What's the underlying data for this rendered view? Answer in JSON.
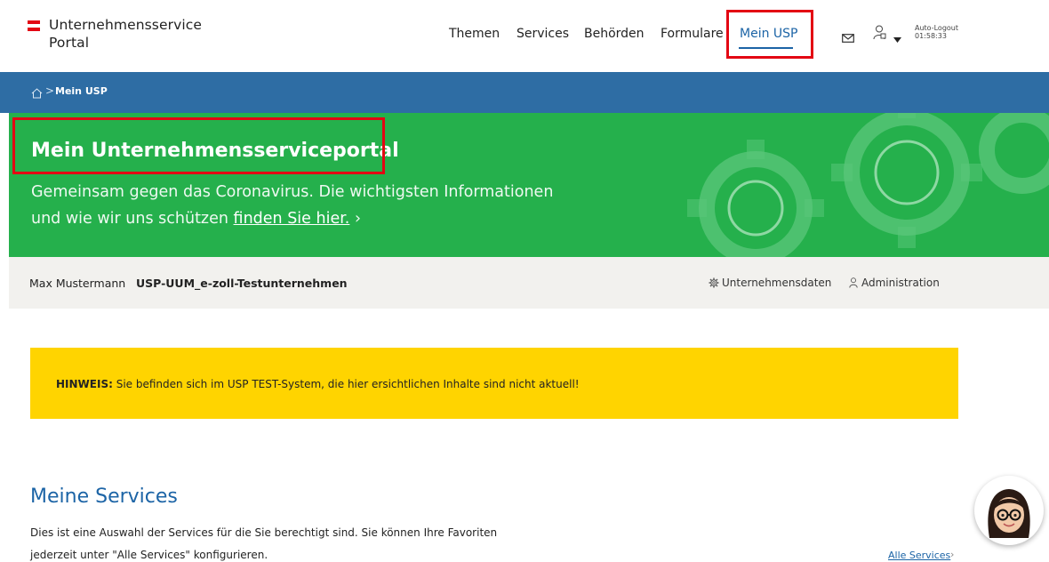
{
  "header": {
    "logo_line1": "Unternehmensservice",
    "logo_line2": "Portal",
    "nav": [
      "Themen",
      "Services",
      "Behörden",
      "Formulare",
      "Mein USP"
    ],
    "active_nav": "Mein USP",
    "auto_logout_label": "Auto-Logout",
    "auto_logout_time": "01:58:33",
    "icons": [
      "mail-icon",
      "user-icon",
      "caret-down-icon"
    ]
  },
  "breadcrumb": {
    "home_icon": "home-icon",
    "separator": ">",
    "current": "Mein USP"
  },
  "hero": {
    "title": "Mein Unternehmensserviceportal",
    "text_line1": "Gemeinsam gegen das Coronavirus. Die wichtigsten Informationen",
    "text_line2_prefix": "und wie wir uns schützen ",
    "link_text": "finden Sie hier.",
    "link_chevron": "›"
  },
  "userbar": {
    "name": "Max Mustermann",
    "company": "USP-UUM_e-zoll-Testunternehmen",
    "company_data_link": "Unternehmensdaten",
    "administration_link": "Administration"
  },
  "notice": {
    "label": "HINWEIS:",
    "text": " Sie befinden sich im USP TEST-System, die hier ersichtlichen Inhalte sind nicht aktuell!"
  },
  "services": {
    "title": "Meine Services",
    "line1": "Dies ist eine Auswahl der Services für die Sie berechtigt sind. Sie können Ihre Favoriten",
    "line2": "jederzeit unter \"Alle Services\" konfigurieren.",
    "all_link": "Alle Services",
    "all_chevron": "›"
  },
  "colors": {
    "brand_blue": "#1c64a6",
    "breadcrumb_blue": "#2e6da4",
    "hero_green": "#25b04c",
    "notice_yellow": "#ffd400",
    "highlight_red": "#e30613"
  }
}
